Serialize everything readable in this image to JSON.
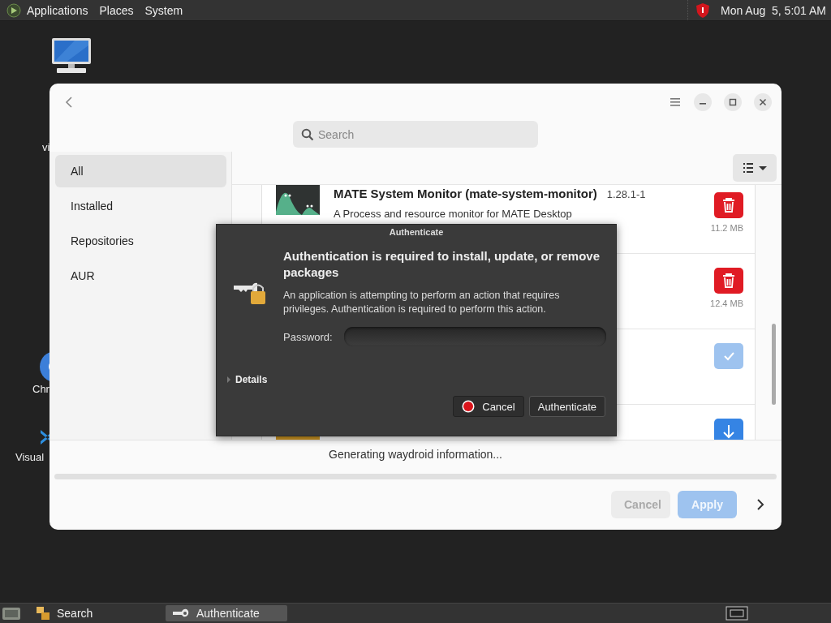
{
  "top_panel": {
    "menus": [
      "Applications",
      "Places",
      "System"
    ],
    "clock": "Mon Aug  5, 5:01 AM"
  },
  "desktop_icons": [
    {
      "label": "vi",
      "kind": "vm"
    },
    {
      "label": "Chr",
      "kind": "chrome"
    },
    {
      "label": "Visual",
      "kind": "vscode"
    }
  ],
  "window": {
    "search": {
      "placeholder": "Search"
    },
    "sidebar": {
      "items": [
        {
          "label": "All",
          "selected": true
        },
        {
          "label": "Installed",
          "selected": false
        },
        {
          "label": "Repositories",
          "selected": false
        },
        {
          "label": "AUR",
          "selected": false
        }
      ]
    },
    "packages": [
      {
        "title": "MATE System Monitor (mate-system-monitor)",
        "version": "1.28.1-1",
        "description": "A Process and resource monitor for MATE Desktop",
        "kind": "remove",
        "size": "11.2 MB"
      },
      {
        "kind": "remove",
        "size": "12.4 MB"
      },
      {
        "kind": "installed"
      },
      {
        "kind": "install"
      }
    ],
    "status": "Generating waydroid information...",
    "progress": {
      "level": 0
    },
    "buttons": [
      {
        "label": "Cancel",
        "kind": "secondary",
        "disabled": true
      },
      {
        "label": "Apply",
        "kind": "primary",
        "disabled": true
      }
    ]
  },
  "dialog": {
    "title": "Authenticate",
    "heading": "Authentication is required to install, update, or remove packages",
    "message": "An application is attempting to perform an action that requires privileges. Authentication is required to perform this action.",
    "password_label": "Password:",
    "details": {
      "label": "Details",
      "expanded": false
    },
    "buttons": [
      {
        "label": "Cancel",
        "kind": "cancel"
      },
      {
        "label": "Authenticate",
        "kind": "default"
      }
    ]
  },
  "taskbar": {
    "tasks": [
      {
        "label": "Search",
        "kind": "files",
        "selected": false
      },
      {
        "label": "Authenticate",
        "kind": "key",
        "selected": true
      }
    ]
  }
}
